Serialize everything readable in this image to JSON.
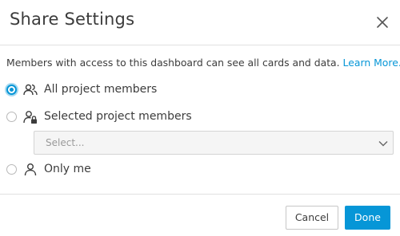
{
  "dialog": {
    "title": "Share Settings",
    "description": "Members with access to this dashboard can see all cards and data.",
    "learn_more": "Learn More."
  },
  "options": [
    {
      "label": "All project members",
      "icon": "group-icon",
      "selected": true
    },
    {
      "label": "Selected project members",
      "icon": "user-lock-icon",
      "selected": false
    },
    {
      "label": "Only me",
      "icon": "user-icon",
      "selected": false
    }
  ],
  "select": {
    "placeholder": "Select..."
  },
  "buttons": {
    "cancel": "Cancel",
    "done": "Done"
  },
  "colors": {
    "accent": "#0696d7",
    "text": "#3c3c3c",
    "border": "#e0e0e0"
  }
}
